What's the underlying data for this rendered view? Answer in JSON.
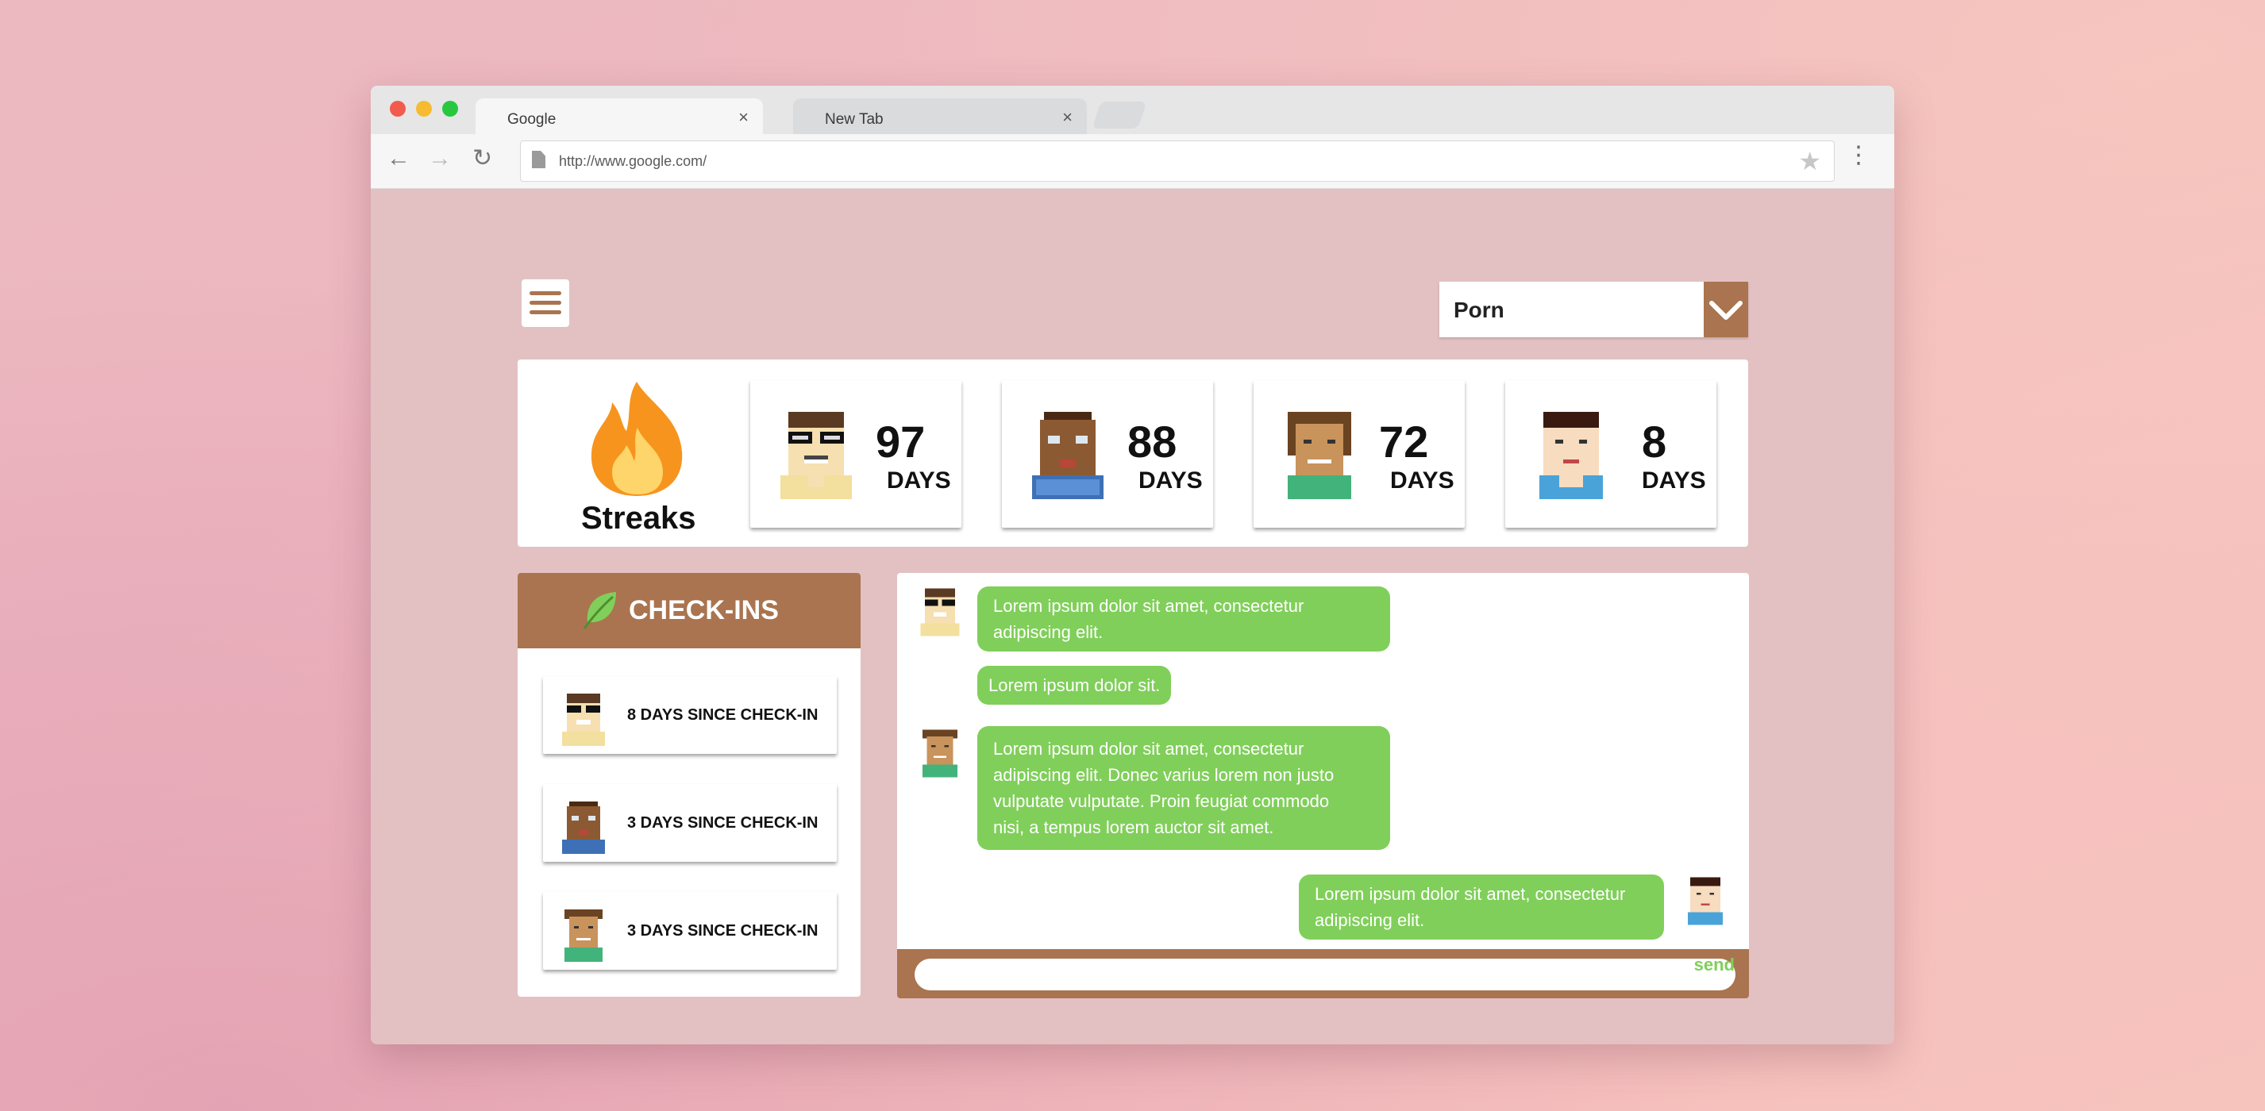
{
  "browser": {
    "tabs": [
      {
        "label": "Google",
        "active": true
      },
      {
        "label": "New Tab",
        "active": false
      }
    ],
    "close_glyph": "×",
    "url": "http://www.google.com/",
    "traffic_lights": [
      "#f25b4d",
      "#f7bb31",
      "#27c83f"
    ]
  },
  "page": {
    "menu_icon": "hamburger-icon",
    "filter": {
      "selected": "Porn"
    },
    "streaks": {
      "title": "Streaks",
      "icon": "flame-icon",
      "people": [
        {
          "value": "97",
          "unit": "DAYS",
          "avatar": "avatar-glasses"
        },
        {
          "value": "88",
          "unit": "DAYS",
          "avatar": "avatar-dark-skin"
        },
        {
          "value": "72",
          "unit": "DAYS",
          "avatar": "avatar-curly-hair"
        },
        {
          "value": "8",
          "unit": "DAYS",
          "avatar": "avatar-black-hair"
        }
      ]
    },
    "checkins": {
      "title": "CHECK-INS",
      "icon": "leaf-icon",
      "items": [
        {
          "label": "8 DAYS SINCE CHECK-IN",
          "avatar": "avatar-glasses"
        },
        {
          "label": "3 DAYS SINCE CHECK-IN",
          "avatar": "avatar-dark-skin"
        },
        {
          "label": "3 DAYS SINCE CHECK-IN",
          "avatar": "avatar-curly-hair"
        }
      ]
    },
    "chat": {
      "messages": [
        {
          "lines": [
            "Lorem ipsum dolor sit amet, consectetur",
            "adipiscing elit."
          ],
          "avatar": "avatar-glasses"
        },
        {
          "lines": [
            "Lorem ipsum dolor sit."
          ],
          "avatar": ""
        },
        {
          "lines": [
            "Lorem ipsum dolor sit amet, consectetur",
            "adipiscing elit. Donec varius lorem non justo",
            "vulputate vulputate. Proin feugiat commodo",
            "nisi, a tempus lorem auctor sit amet."
          ],
          "avatar": "avatar-curly-hair"
        },
        {
          "lines": [
            "Lorem ipsum dolor sit amet, consectetur",
            "adipiscing elit."
          ],
          "avatar": "avatar-black-hair"
        }
      ],
      "send_label": "send"
    },
    "colors": {
      "accent_brown": "#a9744f",
      "bubble_green": "#80cf5a",
      "page_background": "#e3c1c3"
    }
  }
}
